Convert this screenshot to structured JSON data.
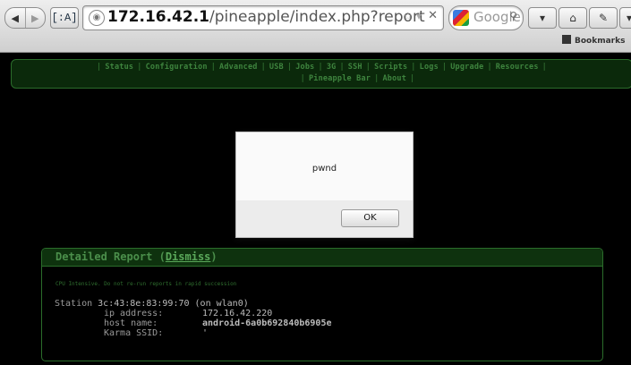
{
  "browser": {
    "url_host": "172.16.42.1",
    "url_path": "/pineapple/index.php?report",
    "search_placeholder": "Google",
    "bookmarks_label": "Bookmarks",
    "mini_button": "[:A]"
  },
  "menu": {
    "row1": [
      "Status",
      "Configuration",
      "Advanced",
      "USB",
      "Jobs",
      "3G",
      "SSH",
      "Scripts",
      "Logs",
      "Upgrade",
      "Resources"
    ],
    "row2": [
      "Pineapple Bar",
      "About"
    ]
  },
  "dialog": {
    "message": "pwnd",
    "ok_label": "OK"
  },
  "report": {
    "title_prefix": "Detailed Report (",
    "dismiss_label": "Dismiss",
    "title_suffix": ")",
    "warning": "CPU Intensive. Do not re-run reports in rapid succession",
    "station_label": "Station",
    "station_value": "3c:43:8e:83:99:70 (on wlan0)",
    "ip_label": "ip address:",
    "ip_value": "172.16.42.220",
    "host_label": "host name:",
    "host_value": "android-6a0b692840b6905e",
    "karma_label": "Karma SSID:",
    "karma_value": "'"
  }
}
